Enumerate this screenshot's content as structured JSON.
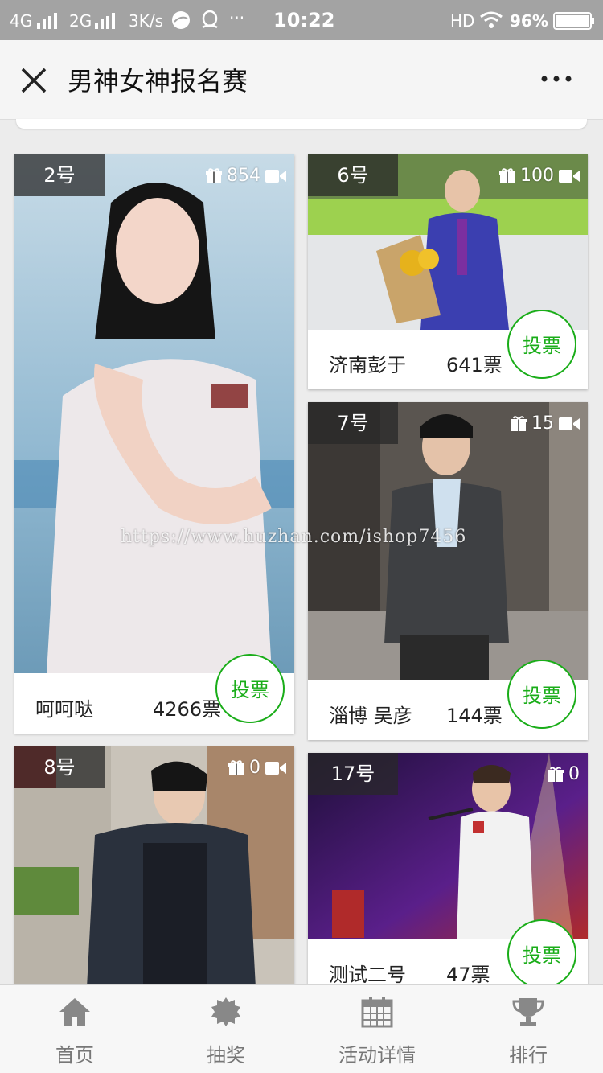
{
  "status_bar": {
    "network1": "4G",
    "network2": "2G",
    "speed": "3K/s",
    "more": "···",
    "time": "10:22",
    "hd": "HD",
    "battery": "96%"
  },
  "nav": {
    "title": "男神女神报名赛"
  },
  "contestants": [
    {
      "number": "2号",
      "gifts": "854",
      "name": "呵呵哒",
      "votes": "4266票",
      "vote_label": "投票"
    },
    {
      "number": "6号",
      "gifts": "100",
      "name": "济南彭于",
      "votes": "641票",
      "vote_label": "投票"
    },
    {
      "number": "7号",
      "gifts": "15",
      "name": "淄博 吴彦",
      "votes": "144票",
      "vote_label": "投票"
    },
    {
      "number": "8号",
      "gifts": "0"
    },
    {
      "number": "17号",
      "gifts": "0",
      "name": "测试二号",
      "votes": "47票",
      "vote_label": "投票"
    }
  ],
  "watermark": "https://www.huzhan.com/ishop7456",
  "tabs": [
    {
      "label": "首页",
      "icon": "home-icon"
    },
    {
      "label": "抽奖",
      "icon": "gear-icon"
    },
    {
      "label": "活动详情",
      "icon": "calendar-icon"
    },
    {
      "label": "排行",
      "icon": "trophy-icon"
    }
  ],
  "colors": {
    "accent": "#1aad19",
    "status_bar": "#a3a3a3",
    "badge_bg": "#282828"
  }
}
